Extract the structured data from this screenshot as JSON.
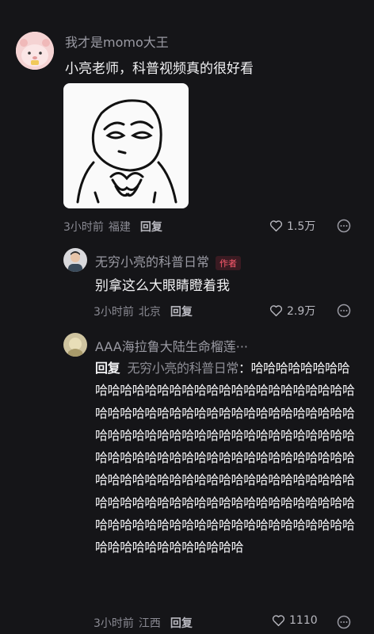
{
  "comment1": {
    "username": "我才是momo大王",
    "text": "小亮老师，科普视频真的很好看",
    "time": "3小时前",
    "location": "福建",
    "reply_label": "回复",
    "likes": "1.5万"
  },
  "reply1": {
    "username": "无穷小亮的科普日常",
    "author_badge": "作者",
    "text": "别拿这么大眼睛瞪着我",
    "time": "3小时前",
    "location": "北京",
    "reply_label": "回复",
    "likes": "2.9万"
  },
  "reply2": {
    "username": "AAA海拉鲁大陆生命榴莲···",
    "reply_word": "回复",
    "reply_to": "无穷小亮的科普日常",
    "text": "：哈哈哈哈哈哈哈哈哈哈哈哈哈哈哈哈哈哈哈哈哈哈哈哈哈哈哈哈哈哈哈哈哈哈哈哈哈哈哈哈哈哈哈哈哈哈哈哈哈哈哈哈哈哈哈哈哈哈哈哈哈哈哈哈哈哈哈哈哈哈哈哈哈哈哈哈哈哈哈哈哈哈哈哈哈哈哈哈哈哈哈哈哈哈哈哈哈哈哈哈哈哈哈哈哈哈哈哈哈哈哈哈哈哈哈哈哈哈哈哈哈哈哈哈哈哈哈哈哈哈哈哈哈哈哈哈哈哈哈哈哈哈哈哈哈哈哈哈哈哈哈哈哈哈哈哈哈哈哈哈哈哈哈哈哈哈哈",
    "time": "3小时前",
    "location": "江西",
    "reply_label": "回复",
    "likes": "1110"
  }
}
